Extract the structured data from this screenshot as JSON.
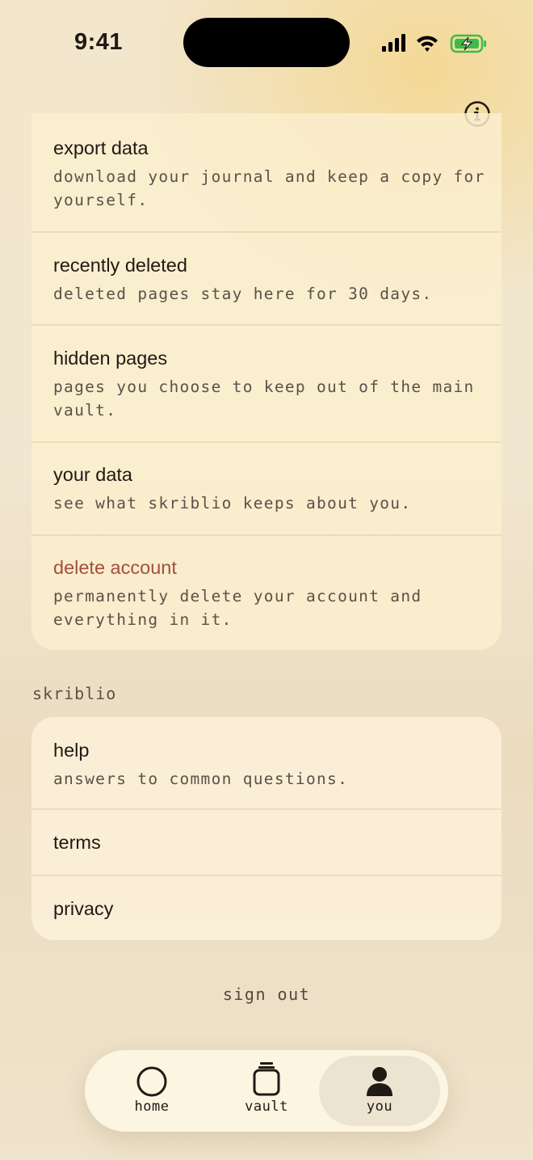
{
  "status": {
    "time": "9:41"
  },
  "account_rows": [
    {
      "title": "export data",
      "desc": "download your journal and keep a copy for yourself."
    },
    {
      "title": "recently deleted",
      "desc": "deleted pages stay here for 30 days."
    },
    {
      "title": "hidden pages",
      "desc": "pages you choose to keep out of the main vault."
    },
    {
      "title": "your data",
      "desc": "see what skriblio keeps about you."
    },
    {
      "title": "delete account",
      "desc": "permanently delete your account and everything in it."
    }
  ],
  "section_label": "skriblio",
  "skriblio_rows": [
    {
      "title": "help",
      "desc": "answers to common questions."
    },
    {
      "title": "terms"
    },
    {
      "title": "privacy"
    }
  ],
  "sign_out": "sign out",
  "tabs": [
    {
      "label": "home",
      "icon": "circle-icon"
    },
    {
      "label": "vault",
      "icon": "jar-icon"
    },
    {
      "label": "you",
      "icon": "person-icon",
      "active": true
    }
  ],
  "colors": {
    "danger": "#a3503a",
    "accent_glow": "#f4d68c"
  }
}
